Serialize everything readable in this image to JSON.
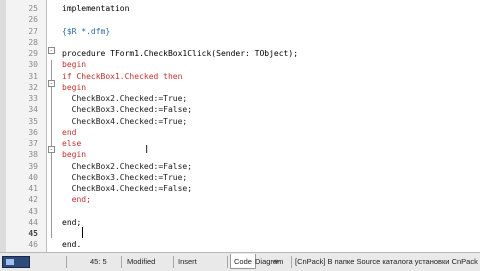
{
  "editor": {
    "line_numbers": [
      "25",
      "26",
      "27",
      "28",
      "29",
      "30",
      "31",
      "32",
      "33",
      "34",
      "35",
      "36",
      "37",
      "38",
      "39",
      "40",
      "41",
      "42",
      "43",
      "44",
      "45",
      "46"
    ],
    "lines": [
      {
        "text": "implementation",
        "style": "kw"
      },
      {
        "text": "",
        "style": ""
      },
      {
        "text": "{$R *.dfm}",
        "style": "comment"
      },
      {
        "text": "",
        "style": ""
      },
      {
        "text": "procedure TForm1.CheckBox1Click(Sender: TObject);",
        "style": "kw"
      },
      {
        "text": "begin",
        "style": "red"
      },
      {
        "text": "if CheckBox1.Checked then",
        "style": "red"
      },
      {
        "text": "begin",
        "style": "red"
      },
      {
        "text": "  CheckBox2.Checked:=True;",
        "style": ""
      },
      {
        "text": "  CheckBox3.Checked:=False;",
        "style": ""
      },
      {
        "text": "  CheckBox4.Checked:=True;",
        "style": ""
      },
      {
        "text": "end",
        "style": "red"
      },
      {
        "text": "else",
        "style": "red"
      },
      {
        "text": "begin",
        "style": "red"
      },
      {
        "text": "  CheckBox2.Checked:=False;",
        "style": ""
      },
      {
        "text": "  CheckBox3.Checked:=True;",
        "style": ""
      },
      {
        "text": "  CheckBox4.Checked:=False;",
        "style": ""
      },
      {
        "text": "  end;",
        "style": "red"
      },
      {
        "text": "",
        "style": ""
      },
      {
        "text": "end;",
        "style": "kw"
      },
      {
        "text": "",
        "style": ""
      },
      {
        "text": "end.",
        "style": "kw"
      }
    ]
  },
  "statusbar": {
    "position": "45:  5",
    "modified": "Modified",
    "insert_mode": "Insert",
    "tab_code": "Code",
    "tab_diagram": "Diagram",
    "message": "[CnPack] В папке Source каталога установки CnPack IDE"
  }
}
